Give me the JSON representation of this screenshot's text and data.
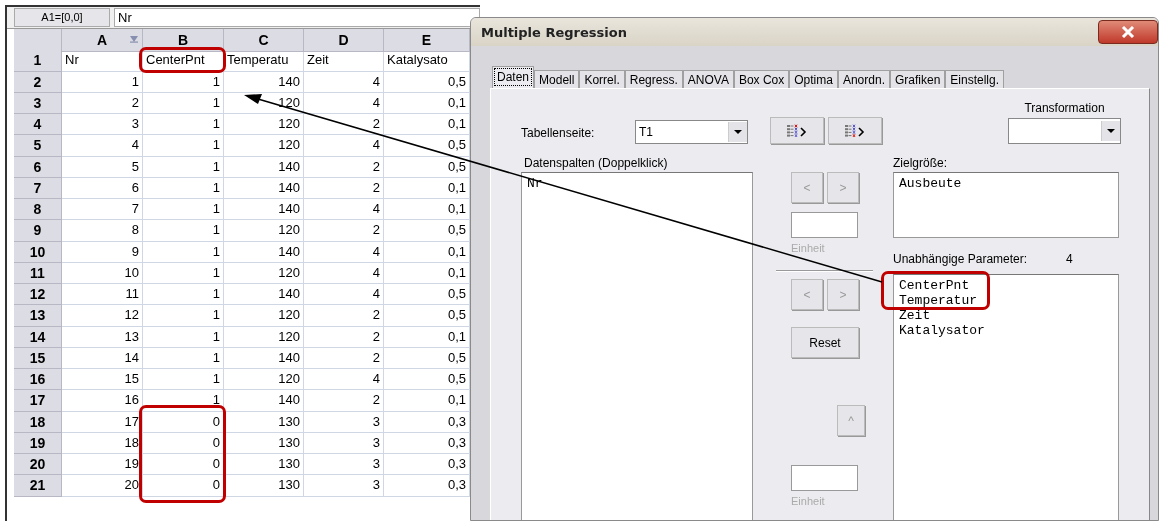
{
  "spreadsheet": {
    "cell_reference": "A1=[0,0]",
    "formula": "Nr",
    "columns": [
      {
        "label": "A",
        "filter": true
      },
      {
        "label": "B",
        "filter": false
      },
      {
        "label": "C",
        "filter": false
      },
      {
        "label": "D",
        "filter": false
      },
      {
        "label": "E",
        "filter": false
      }
    ],
    "rows": [
      {
        "label": "1",
        "cells": [
          "Nr",
          "CenterPnt",
          "Temperatu",
          "Zeit",
          "Katalysato"
        ]
      },
      {
        "label": "2",
        "cells": [
          "1",
          "1",
          "140",
          "4",
          "0,5"
        ]
      },
      {
        "label": "3",
        "cells": [
          "2",
          "1",
          "120",
          "4",
          "0,1"
        ]
      },
      {
        "label": "4",
        "cells": [
          "3",
          "1",
          "120",
          "2",
          "0,1"
        ]
      },
      {
        "label": "5",
        "cells": [
          "4",
          "1",
          "120",
          "4",
          "0,5"
        ]
      },
      {
        "label": "6",
        "cells": [
          "5",
          "1",
          "140",
          "2",
          "0,5"
        ]
      },
      {
        "label": "7",
        "cells": [
          "6",
          "1",
          "140",
          "2",
          "0,1"
        ]
      },
      {
        "label": "8",
        "cells": [
          "7",
          "1",
          "140",
          "4",
          "0,1"
        ]
      },
      {
        "label": "9",
        "cells": [
          "8",
          "1",
          "120",
          "2",
          "0,5"
        ]
      },
      {
        "label": "10",
        "cells": [
          "9",
          "1",
          "140",
          "4",
          "0,1"
        ]
      },
      {
        "label": "11",
        "cells": [
          "10",
          "1",
          "120",
          "4",
          "0,1"
        ]
      },
      {
        "label": "12",
        "cells": [
          "11",
          "1",
          "140",
          "4",
          "0,5"
        ]
      },
      {
        "label": "13",
        "cells": [
          "12",
          "1",
          "120",
          "2",
          "0,5"
        ]
      },
      {
        "label": "14",
        "cells": [
          "13",
          "1",
          "120",
          "2",
          "0,1"
        ]
      },
      {
        "label": "15",
        "cells": [
          "14",
          "1",
          "140",
          "2",
          "0,5"
        ]
      },
      {
        "label": "16",
        "cells": [
          "15",
          "1",
          "120",
          "4",
          "0,5"
        ]
      },
      {
        "label": "17",
        "cells": [
          "16",
          "1",
          "140",
          "2",
          "0,1"
        ]
      },
      {
        "label": "18",
        "cells": [
          "17",
          "0",
          "130",
          "3",
          "0,3"
        ]
      },
      {
        "label": "19",
        "cells": [
          "18",
          "0",
          "130",
          "3",
          "0,3"
        ]
      },
      {
        "label": "20",
        "cells": [
          "19",
          "0",
          "130",
          "3",
          "0,3"
        ]
      },
      {
        "label": "21",
        "cells": [
          "20",
          "0",
          "130",
          "3",
          "0,3"
        ]
      }
    ]
  },
  "dialog": {
    "title": "Multiple Regression",
    "tabs": [
      {
        "label": "Daten",
        "selected": true
      },
      {
        "label": "Modell",
        "selected": false
      },
      {
        "label": "Korrel.",
        "selected": false
      },
      {
        "label": "Regress.",
        "selected": false
      },
      {
        "label": "ANOVA",
        "selected": false
      },
      {
        "label": "Box Cox",
        "selected": false
      },
      {
        "label": "Optima",
        "selected": false
      },
      {
        "label": "Anordn.",
        "selected": false
      },
      {
        "label": "Grafiken",
        "selected": false
      },
      {
        "label": "Einstellg.",
        "selected": false
      }
    ],
    "table_sheet": {
      "label": "Tabellenseite:",
      "value": "T1"
    },
    "transformation": {
      "label": "Transformation"
    },
    "data_columns": {
      "label": "Datenspalten (Doppelklick)",
      "items": [
        "Nr"
      ]
    },
    "target": {
      "label": "Zielgröße:",
      "items": [
        "Ausbeute"
      ],
      "unit_label": "Einheit"
    },
    "independent": {
      "label": "Unabhängige Parameter:",
      "count": "4",
      "items": [
        "CenterPnt",
        "Temperatur",
        "Zeit",
        "Katalysator"
      ],
      "unit_label": "Einheit"
    },
    "move_buttons": [
      {
        "label": "<",
        "disabled": true
      },
      {
        "label": ">",
        "disabled": true
      },
      {
        "label": "<",
        "disabled": true
      },
      {
        "label": ">",
        "disabled": true
      }
    ],
    "reset_button": {
      "label": "Reset",
      "disabled": false
    },
    "up_button": {
      "label": "^",
      "disabled": true
    }
  }
}
